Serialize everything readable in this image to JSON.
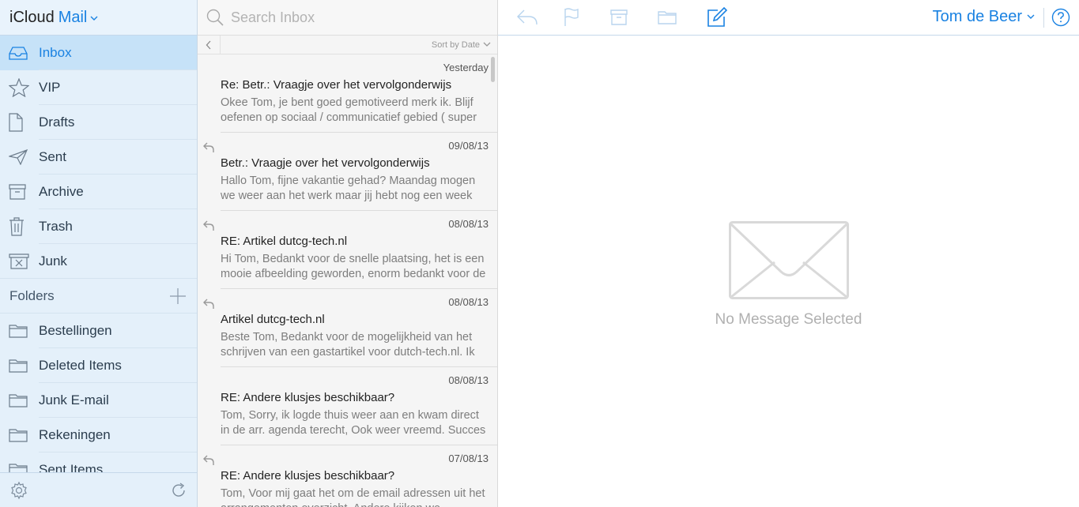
{
  "brand": {
    "icloud": "iCloud",
    "app": "Mail"
  },
  "sidebar": {
    "mailboxes": [
      {
        "label": "Inbox",
        "icon": "inbox-icon",
        "selected": true
      },
      {
        "label": "VIP",
        "icon": "star-icon"
      },
      {
        "label": "Drafts",
        "icon": "document-icon"
      },
      {
        "label": "Sent",
        "icon": "paper-plane-icon"
      },
      {
        "label": "Archive",
        "icon": "archive-box-icon"
      },
      {
        "label": "Trash",
        "icon": "trash-icon"
      },
      {
        "label": "Junk",
        "icon": "junk-box-icon"
      }
    ],
    "folders_label": "Folders",
    "folders": [
      {
        "label": "Bestellingen"
      },
      {
        "label": "Deleted Items"
      },
      {
        "label": "Junk E-mail"
      },
      {
        "label": "Rekeningen"
      },
      {
        "label": "Sent Items"
      }
    ]
  },
  "search": {
    "placeholder": "Search Inbox"
  },
  "sort": {
    "label": "Sort by Date"
  },
  "messages": [
    {
      "date": "Yesterday",
      "replied": false,
      "subject": "Re: Betr.: Vraagje over het vervolgonderwijs",
      "preview": "Okee Tom, je bent goed gemotiveerd merk ik. Blijf oefenen op sociaal / communicatief gebied ( super"
    },
    {
      "date": "09/08/13",
      "replied": true,
      "subject": "Betr.: Vraagje over het vervolgonderwijs",
      "preview": "Hallo Tom, fijne vakantie gehad? Maandag mogen we weer aan het werk maar jij hebt nog een week"
    },
    {
      "date": "08/08/13",
      "replied": true,
      "subject": "RE: Artikel dutcg-tech.nl",
      "preview": "Hi Tom, Bedankt voor de snelle plaatsing, het is een mooie afbeelding geworden, enorm bedankt voor de"
    },
    {
      "date": "08/08/13",
      "replied": true,
      "subject": "Artikel dutcg-tech.nl",
      "preview": "Beste Tom, Bedankt voor de mogelijkheid van het schrijven van een gastartikel voor dutch-tech.nl. Ik"
    },
    {
      "date": "08/08/13",
      "replied": false,
      "subject": "RE: Andere klusjes beschikbaar?",
      "preview": "Tom, Sorry, ik logde thuis weer aan en kwam direct in de arr. agenda terecht, Ook weer vreemd. Succes"
    },
    {
      "date": "07/08/13",
      "replied": true,
      "subject": "RE: Andere klusjes beschikbaar?",
      "preview": "Tom, Voor mij gaat het om de email adressen uit het arrangementen overzicht. Andere kijken we"
    }
  ],
  "toolbar": {
    "user_name": "Tom de Beer"
  },
  "reading_pane": {
    "empty_label": "No Message Selected"
  },
  "colors": {
    "accent": "#1a82e2",
    "sidebar_bg": "#e4f0fa",
    "selected_bg": "#c6e2f8"
  }
}
